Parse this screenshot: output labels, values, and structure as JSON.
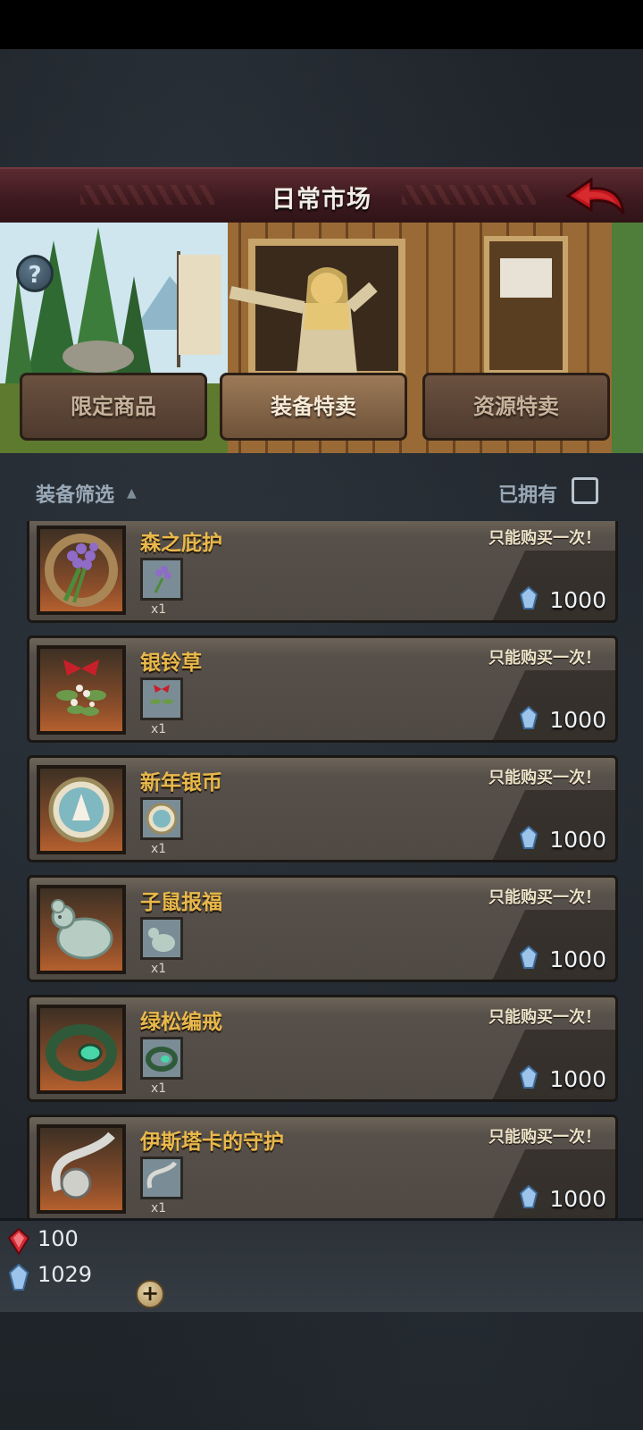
{
  "header": {
    "title": "日常市场"
  },
  "icons": {
    "back": "back-arrow-icon",
    "help": "help-icon",
    "crystal": "blue-crystal-icon",
    "ruby": "red-gem-icon",
    "add": "plus-icon"
  },
  "banner": {
    "help_label": "?"
  },
  "tabs": [
    {
      "label": "限定商品",
      "active": false
    },
    {
      "label": "装备特卖",
      "active": true
    },
    {
      "label": "资源特卖",
      "active": false
    }
  ],
  "filter": {
    "label": "装备筛选",
    "caret": "▲",
    "owned_label": "已拥有",
    "owned_checked": false
  },
  "items": [
    {
      "name": "森之庇护",
      "limit": "只能购买一次！",
      "qty": "x1",
      "price": "1000",
      "icon": "lavender-bundle-icon"
    },
    {
      "name": "银铃草",
      "limit": "只能购买一次！",
      "qty": "x1",
      "price": "1000",
      "icon": "mistletoe-icon"
    },
    {
      "name": "新年银币",
      "limit": "只能购买一次！",
      "qty": "x1",
      "price": "1000",
      "icon": "silver-coin-icon"
    },
    {
      "name": "子鼠报福",
      "limit": "只能购买一次！",
      "qty": "x1",
      "price": "1000",
      "icon": "jade-rat-icon"
    },
    {
      "name": "绿松编戒",
      "limit": "只能购买一次！",
      "qty": "x1",
      "price": "1000",
      "icon": "turquoise-ring-icon"
    },
    {
      "name": "伊斯塔卡的守护",
      "limit": "只能购买一次！",
      "qty": "x1",
      "price": "1000",
      "icon": "silver-charm-icon"
    }
  ],
  "wallet": {
    "ruby": "100",
    "crystal": "1029",
    "add_label": "+"
  },
  "colors": {
    "title_bar": "#4a2026",
    "item_name": "#e9b84a",
    "tab_active": "#9c7a58"
  }
}
